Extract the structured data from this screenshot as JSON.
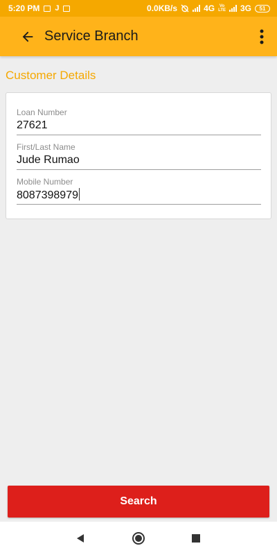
{
  "status_bar": {
    "time": "5:20 PM",
    "letter": "J",
    "network_speed": "0.0KB/s",
    "net_4g": "4G",
    "volte": "Vo\nLTE",
    "net_3g": "3G",
    "battery": "51"
  },
  "app_bar": {
    "title": "Service Branch",
    "back_icon": "arrow-left-icon",
    "menu_icon": "more-vert-icon"
  },
  "section": {
    "title": "Customer Details"
  },
  "form": {
    "loan_number": {
      "label": "Loan Number",
      "value": "27621"
    },
    "name": {
      "label": "First/Last Name",
      "value": "Jude Rumao"
    },
    "mobile": {
      "label": "Mobile Number",
      "value": "8087398979"
    }
  },
  "search_button": {
    "label": "Search"
  },
  "nav": {
    "back_icon": "triangle-back-icon",
    "home_icon": "circle-home-icon",
    "recents_icon": "square-recents-icon"
  },
  "colors": {
    "status_bar": "#f5a800",
    "app_bar": "#ffb31a",
    "accent_text": "#f5a800",
    "button": "#dd1f1b",
    "background": "#eeeeee"
  }
}
